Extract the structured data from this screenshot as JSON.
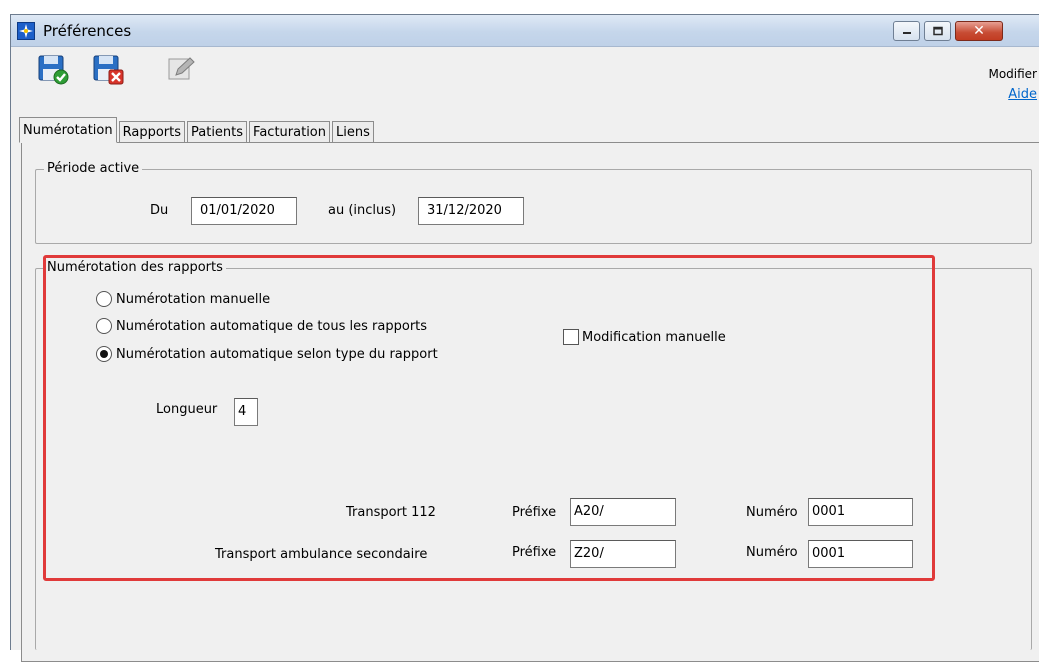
{
  "window": {
    "title": "Préférences"
  },
  "menu": {
    "modifier": "Modifier",
    "aide": "Aide"
  },
  "tabs": [
    {
      "label": "Numérotation",
      "active": true
    },
    {
      "label": "Rapports",
      "active": false
    },
    {
      "label": "Patients",
      "active": false
    },
    {
      "label": "Facturation",
      "active": false
    },
    {
      "label": "Liens",
      "active": false
    }
  ],
  "periode": {
    "legend": "Période active",
    "du_label": "Du",
    "du_value": "01/01/2020",
    "au_label": "au (inclus)",
    "au_value": "31/12/2020"
  },
  "numerotation": {
    "legend": "Numérotation des rapports",
    "options": [
      {
        "label": "Numérotation manuelle",
        "checked": false
      },
      {
        "label": "Numérotation automatique de tous les rapports",
        "checked": false
      },
      {
        "label": "Numérotation automatique selon type du rapport",
        "checked": true
      }
    ],
    "modification_manuelle": {
      "label": "Modification manuelle",
      "checked": false
    },
    "longueur_label": "Longueur",
    "longueur_value": "4",
    "rows": [
      {
        "type": "Transport 112",
        "prefix_label": "Préfixe",
        "prefix": "A20/",
        "numero_label": "Numéro",
        "numero": "0001"
      },
      {
        "type": "Transport ambulance secondaire",
        "prefix_label": "Préfixe",
        "prefix": "Z20/",
        "numero_label": "Numéro",
        "numero": "0001"
      }
    ]
  },
  "colors": {
    "highlight": "#e03a3a",
    "link": "#0066cc"
  }
}
